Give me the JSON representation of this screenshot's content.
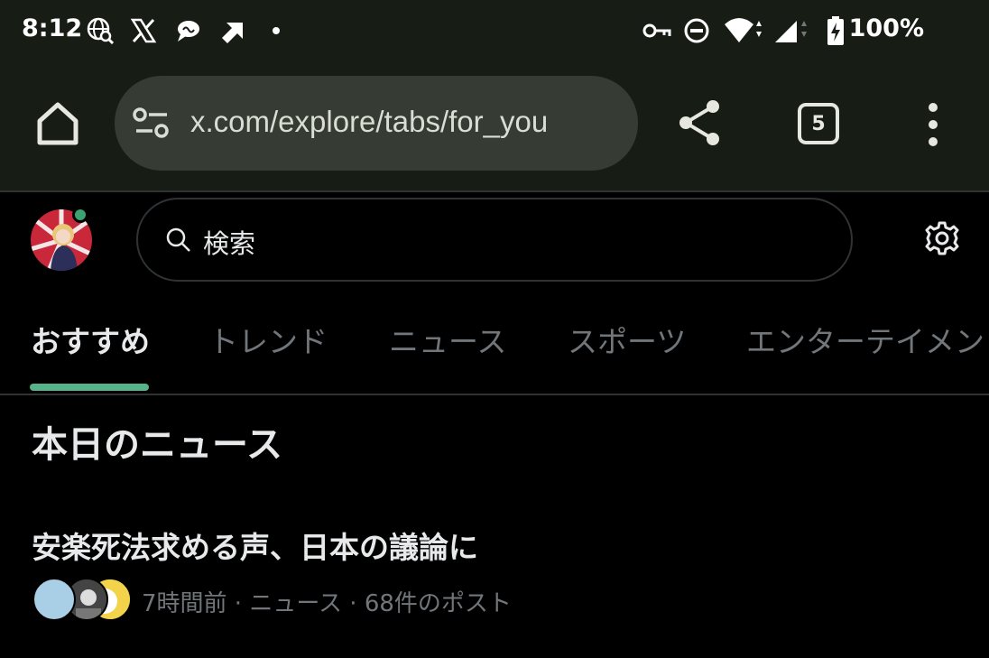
{
  "status_bar": {
    "time": "8:12",
    "battery": "100%",
    "icons": [
      "globe-search-icon",
      "x-logo-icon",
      "chat-bubble-icon",
      "arrow-up-right-icon",
      "dot-icon",
      "vpn-key-icon",
      "do-not-disturb-icon",
      "wifi-icon",
      "signal-icon",
      "battery-charging-icon"
    ]
  },
  "browser": {
    "url": "x.com/explore/tabs/for_you",
    "tab_count": "5"
  },
  "header": {
    "search_placeholder": "検索"
  },
  "tabs": [
    {
      "label": "おすすめ",
      "active": true
    },
    {
      "label": "トレンド",
      "active": false
    },
    {
      "label": "ニュース",
      "active": false
    },
    {
      "label": "スポーツ",
      "active": false
    },
    {
      "label": "エンターテイメン",
      "active": false
    }
  ],
  "content": {
    "section_title": "本日のニュース",
    "news_item": {
      "headline": "安楽死法求める声、日本の議論に",
      "meta": "7時間前 · ニュース · 68件のポスト"
    }
  },
  "colors": {
    "accent": "#56b38a",
    "browser_chrome": "#171c14",
    "url_pill": "#363b33",
    "muted_text": "#71767b"
  }
}
